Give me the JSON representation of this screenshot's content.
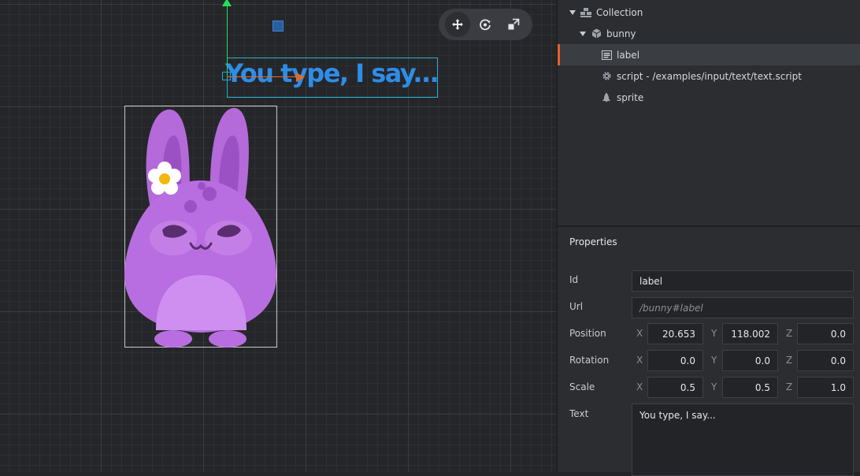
{
  "scene": {
    "label_text": "You type, I say...",
    "toolbar": {
      "move_icon": "move-icon",
      "rotate_icon": "rotate-icon",
      "scale_icon": "scale-icon"
    }
  },
  "outline": {
    "items": [
      {
        "label": "Collection",
        "icon": "collection-icon"
      },
      {
        "label": "bunny",
        "icon": "game-object-icon"
      },
      {
        "label": "label",
        "icon": "label-icon"
      },
      {
        "label": "script - /examples/input/text/text.script",
        "icon": "gear-icon"
      },
      {
        "label": "sprite",
        "icon": "sprite-icon"
      }
    ]
  },
  "properties": {
    "title": "Properties",
    "id_label": "Id",
    "id_value": "label",
    "url_label": "Url",
    "url_value": "/bunny#label",
    "position_label": "Position",
    "rotation_label": "Rotation",
    "scale_label": "Scale",
    "text_label": "Text",
    "axis_x": "X",
    "axis_y": "Y",
    "axis_z": "Z",
    "position": {
      "x": "20.653",
      "y": "118.002",
      "z": "0.0"
    },
    "rotation": {
      "x": "0.0",
      "y": "0.0",
      "z": "0.0"
    },
    "scale": {
      "x": "0.5",
      "y": "0.5",
      "z": "1.0"
    },
    "text_value": "You type, I say..."
  },
  "colors": {
    "selection_accent": "#e8602a",
    "label_text": "#2e8de8",
    "gizmo_y": "#22e05a",
    "gizmo_x": "#e06a2a",
    "bunny_body": "#b86ee0"
  }
}
